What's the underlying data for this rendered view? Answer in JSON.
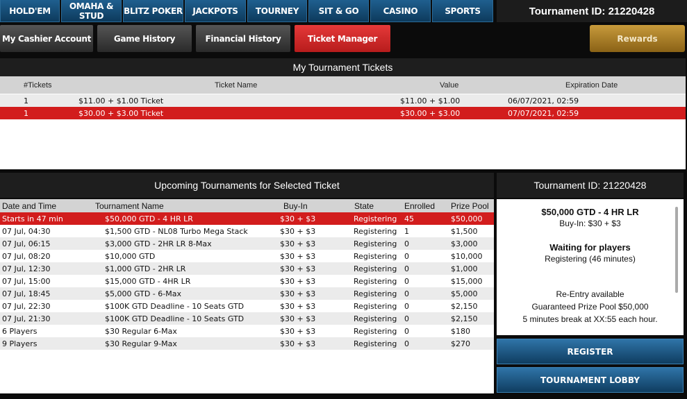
{
  "nav": {
    "tabs": [
      {
        "label": "HOLD'EM"
      },
      {
        "label": "OMAHA & STUD"
      },
      {
        "label": "BLITZ POKER"
      },
      {
        "label": "JACKPOTS"
      },
      {
        "label": "TOURNEY"
      },
      {
        "label": "SIT & GO"
      },
      {
        "label": "CASINO"
      },
      {
        "label": "SPORTS"
      }
    ],
    "tournament_id": "Tournament ID: 21220428"
  },
  "subnav": {
    "items": [
      {
        "label": "My Cashier Account"
      },
      {
        "label": "Game History"
      },
      {
        "label": "Financial History"
      },
      {
        "label": "Ticket Manager"
      }
    ],
    "rewards": "Rewards"
  },
  "tickets": {
    "title": "My Tournament Tickets",
    "columns": [
      "#Tickets",
      "Ticket Name",
      "Value",
      "Expiration Date"
    ],
    "rows": [
      {
        "count": "1",
        "name": "$11.00 + $1.00 Ticket",
        "value": "$11.00 + $1.00",
        "expires": "06/07/2021, 02:59"
      },
      {
        "count": "1",
        "name": "$30.00 + $3.00 Ticket",
        "value": "$30.00 + $3.00",
        "expires": "07/07/2021, 02:59"
      }
    ]
  },
  "upcoming": {
    "title": "Upcoming Tournaments for Selected Ticket",
    "columns": [
      "Date and Time",
      "Tournament Name",
      "Buy-In",
      "State",
      "Enrolled",
      "Prize Pool"
    ],
    "rows": [
      {
        "time": "Starts in 47 min",
        "name": "$50,000 GTD - 4 HR LR",
        "buyin": "$30 + $3",
        "state": "Registering",
        "enrolled": "45",
        "prize": "$50,000"
      },
      {
        "time": "07 Jul, 04:30",
        "name": "$1,500 GTD - NL08 Turbo Mega Stack",
        "buyin": "$30 + $3",
        "state": "Registering",
        "enrolled": "1",
        "prize": "$1,500"
      },
      {
        "time": "07 Jul, 06:15",
        "name": "$3,000 GTD - 2HR LR 8-Max",
        "buyin": "$30 + $3",
        "state": "Registering",
        "enrolled": "0",
        "prize": "$3,000"
      },
      {
        "time": "07 Jul, 08:20",
        "name": "$10,000 GTD",
        "buyin": "$30 + $3",
        "state": "Registering",
        "enrolled": "0",
        "prize": "$10,000"
      },
      {
        "time": "07 Jul, 12:30",
        "name": "$1,000 GTD - 2HR LR",
        "buyin": "$30 + $3",
        "state": "Registering",
        "enrolled": "0",
        "prize": "$1,000"
      },
      {
        "time": "07 Jul, 15:00",
        "name": "$15,000 GTD - 4HR LR",
        "buyin": "$30 + $3",
        "state": "Registering",
        "enrolled": "0",
        "prize": "$15,000"
      },
      {
        "time": "07 Jul, 18:45",
        "name": "$5,000 GTD - 6-Max",
        "buyin": "$30 + $3",
        "state": "Registering",
        "enrolled": "0",
        "prize": "$5,000"
      },
      {
        "time": "07 Jul, 22:30",
        "name": "$100K GTD Deadline - 10 Seats GTD",
        "buyin": "$30 + $3",
        "state": "Registering",
        "enrolled": "0",
        "prize": "$2,150"
      },
      {
        "time": "07 Jul, 21:30",
        "name": "$100K GTD Deadline - 10 Seats GTD",
        "buyin": "$30 + $3",
        "state": "Registering",
        "enrolled": "0",
        "prize": "$2,150"
      },
      {
        "time": "6 Players",
        "name": "$30 Regular 6-Max",
        "buyin": "$30 + $3",
        "state": "Registering",
        "enrolled": "0",
        "prize": "$180"
      },
      {
        "time": "9 Players",
        "name": "$30 Regular 9-Max",
        "buyin": "$30 + $3",
        "state": "Registering",
        "enrolled": "0",
        "prize": "$270"
      }
    ]
  },
  "detail": {
    "header": "Tournament ID: 21220428",
    "name": "$50,000 GTD - 4 HR LR",
    "buyin": "Buy-In: $30 + $3",
    "status_title": "Waiting for players",
    "status_line": "Registering  (46 minutes)",
    "reentry": "Re-Entry available",
    "guaranteed": "Guaranteed Prize Pool $50,000",
    "breaks": "5 minutes break at XX:55 each hour.",
    "register": "REGISTER",
    "lobby": "TOURNAMENT LOBBY"
  },
  "colors": {
    "selected_row": "#d21d1d",
    "nav_blue": "#1f5f8f",
    "rewards_gold": "#b8862e"
  }
}
